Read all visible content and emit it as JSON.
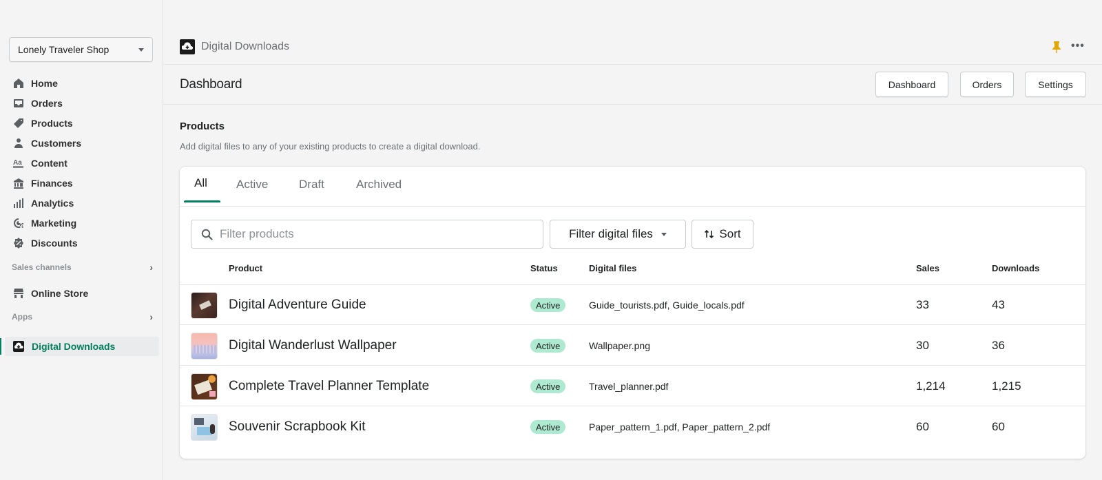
{
  "sidebar": {
    "shop_name": "Lonely Traveler Shop",
    "nav": [
      {
        "label": "Home",
        "icon": "home-icon"
      },
      {
        "label": "Orders",
        "icon": "orders-icon"
      },
      {
        "label": "Products",
        "icon": "tag-icon"
      },
      {
        "label": "Customers",
        "icon": "person-icon"
      },
      {
        "label": "Content",
        "icon": "content-icon"
      },
      {
        "label": "Finances",
        "icon": "bank-icon"
      },
      {
        "label": "Analytics",
        "icon": "bar-chart-icon"
      },
      {
        "label": "Marketing",
        "icon": "target-icon"
      },
      {
        "label": "Discounts",
        "icon": "discount-icon"
      }
    ],
    "sales_channels_label": "Sales channels",
    "online_store_label": "Online Store",
    "apps_label": "Apps",
    "active_app_label": "Digital Downloads"
  },
  "app": {
    "title": "Digital Downloads",
    "accent_color": "#008060",
    "pin_color": "#e0a800"
  },
  "page": {
    "title": "Dashboard",
    "buttons": {
      "dashboard": "Dashboard",
      "orders": "Orders",
      "settings": "Settings"
    }
  },
  "products": {
    "heading": "Products",
    "description": "Add digital files to any of your existing products to create a digital download.",
    "tabs": [
      {
        "label": "All",
        "selected": true
      },
      {
        "label": "Active",
        "selected": false
      },
      {
        "label": "Draft",
        "selected": false
      },
      {
        "label": "Archived",
        "selected": false
      }
    ],
    "search_placeholder": "Filter products",
    "filter_label": "Filter digital files",
    "sort_label": "Sort",
    "columns": {
      "product": "Product",
      "status": "Status",
      "files": "Digital files",
      "sales": "Sales",
      "downloads": "Downloads"
    },
    "rows": [
      {
        "name": "Digital Adventure Guide",
        "status": "Active",
        "files": "Guide_tourists.pdf, Guide_locals.pdf",
        "sales": "33",
        "downloads": "43"
      },
      {
        "name": "Digital Wanderlust Wallpaper",
        "status": "Active",
        "files": "Wallpaper.png",
        "sales": "30",
        "downloads": "36"
      },
      {
        "name": "Complete Travel Planner Template",
        "status": "Active",
        "files": "Travel_planner.pdf",
        "sales": "1,214",
        "downloads": "1,215"
      },
      {
        "name": "Souvenir Scrapbook Kit",
        "status": "Active",
        "files": "Paper_pattern_1.pdf, Paper_pattern_2.pdf",
        "sales": "60",
        "downloads": "60"
      }
    ]
  }
}
